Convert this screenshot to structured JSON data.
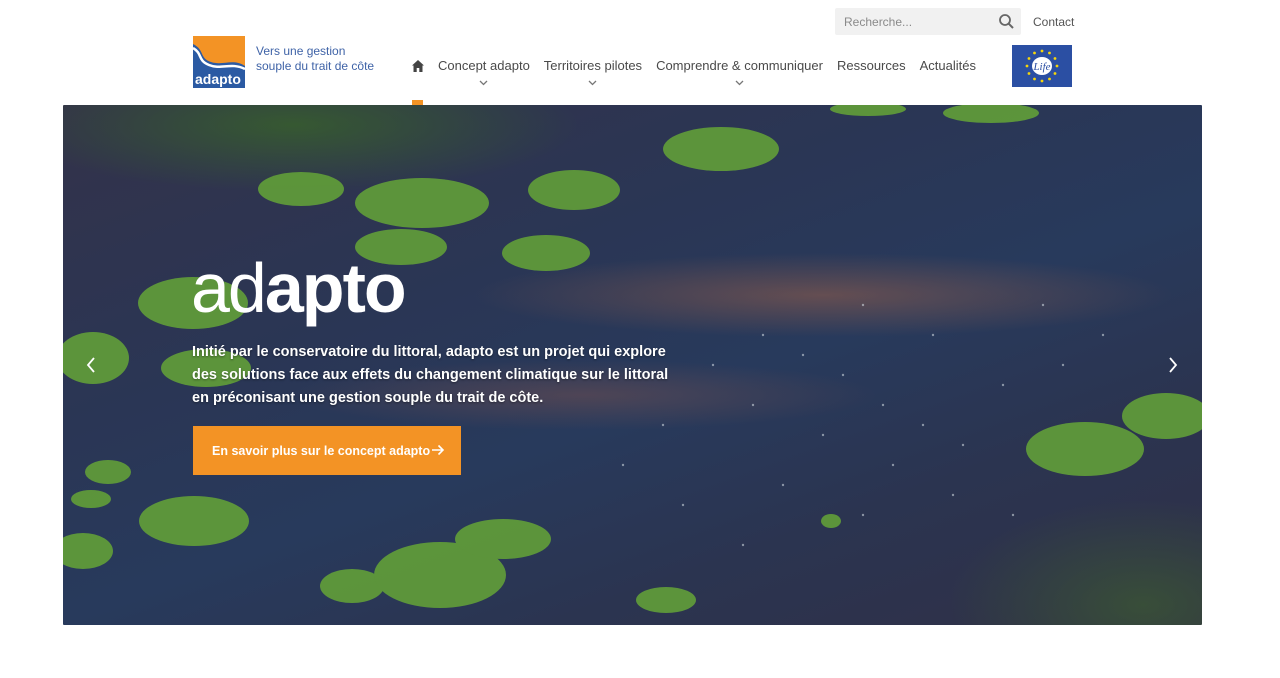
{
  "brand": {
    "logo_text": "adapto",
    "tagline_line1": "Vers une gestion",
    "tagline_line2": "souple du trait de côte"
  },
  "search": {
    "placeholder": "Recherche..."
  },
  "utility": {
    "contact_label": "Contact"
  },
  "nav": {
    "items": [
      {
        "label": "Concept adapto",
        "has_dropdown": true
      },
      {
        "label": "Territoires pilotes",
        "has_dropdown": true
      },
      {
        "label": "Comprendre & communiquer",
        "has_dropdown": true
      },
      {
        "label": "Ressources",
        "has_dropdown": false
      },
      {
        "label": "Actualités",
        "has_dropdown": false
      }
    ],
    "active_item": "home"
  },
  "partner_logo": {
    "text": "Life"
  },
  "hero": {
    "logo_thin": "ad",
    "logo_bold": "apto",
    "text": "Initié par le conservatoire du littoral, adapto est un projet qui explore des solutions face aux effets du changement climatique sur le littoral en préconisant une gestion souple du trait de côte.",
    "cta_label": "En savoir plus sur le concept adapto"
  },
  "colors": {
    "accent": "#f39325",
    "brand_blue": "#3f63a7",
    "eu_blue": "#2b4fa3",
    "eu_star": "#f5d60a"
  },
  "icons": [
    "home-icon",
    "search-icon",
    "chevron-down-icon",
    "arrow-right-icon",
    "chevron-left-icon",
    "chevron-right-icon"
  ]
}
